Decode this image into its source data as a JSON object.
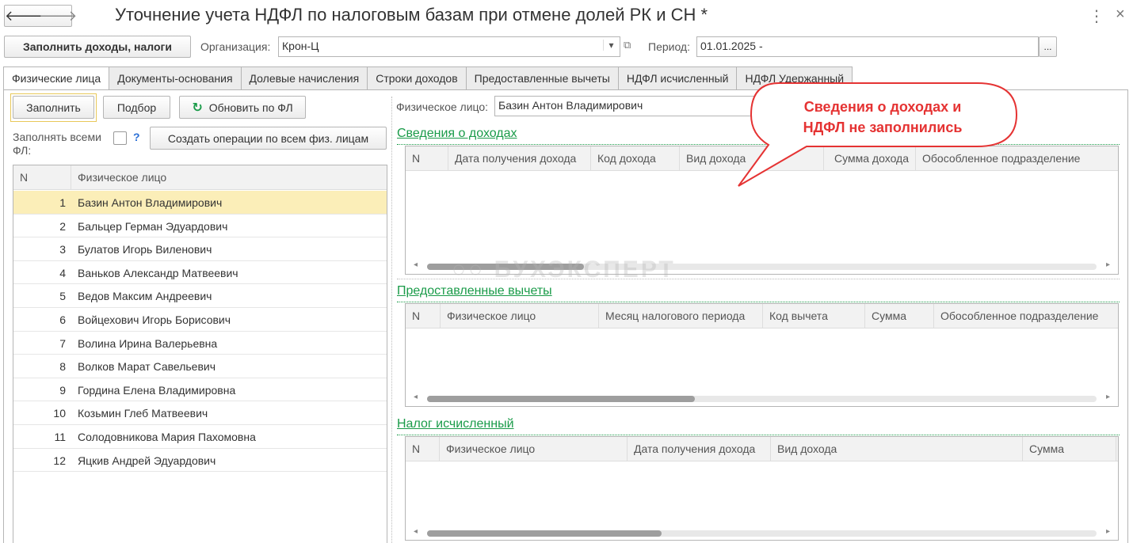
{
  "header": {
    "title": "Уточнение учета НДФЛ по налоговым базам при отмене долей РК и СН *",
    "back_glyph": "🡐",
    "forward_glyph": "🡒",
    "more_glyph": "⋮",
    "close_glyph": "×"
  },
  "toolbar": {
    "fill_button": "Заполнить доходы, налоги",
    "org_label": "Организация:",
    "org_value": "Крон-Ц",
    "period_label": "Период:",
    "period_value": "01.01.2025 -",
    "dropdown_glyph": "▾",
    "open_glyph": "⧉",
    "select_glyph": "..."
  },
  "tabs": [
    "Физические лица",
    "Документы-основания",
    "Долевые начисления",
    "Строки доходов",
    "Предоставленные вычеты",
    "НДФЛ исчисленный",
    "НДФЛ Удержанный"
  ],
  "left": {
    "fill_button": "Заполнить",
    "pick_button": "Подбор",
    "refresh_button": "Обновить по ФЛ",
    "fill_all_label_1": "Заполнять всеми",
    "fill_all_label_2": "ФЛ:",
    "help_glyph": "?",
    "create_ops_button": "Создать операции по всем физ. лицам",
    "table_headers": [
      "N",
      "Физическое лицо"
    ],
    "persons": [
      {
        "n": "1",
        "name": "Базин Антон Владимирович"
      },
      {
        "n": "2",
        "name": "Бальцер Герман Эдуардович"
      },
      {
        "n": "3",
        "name": "Булатов Игорь Виленович"
      },
      {
        "n": "4",
        "name": "Ваньков Александр Матвеевич"
      },
      {
        "n": "5",
        "name": "Ведов Максим Андреевич"
      },
      {
        "n": "6",
        "name": "Войцехович Игорь Борисович"
      },
      {
        "n": "7",
        "name": "Волина Ирина Валерьевна"
      },
      {
        "n": "8",
        "name": "Волков Марат Савельевич"
      },
      {
        "n": "9",
        "name": "Гордина Елена Владимировна"
      },
      {
        "n": "10",
        "name": "Козьмин Глеб Матвеевич"
      },
      {
        "n": "11",
        "name": "Солодовникова Мария Пахомовна"
      },
      {
        "n": "12",
        "name": "Яцкив Андрей Эдуардович"
      }
    ]
  },
  "right": {
    "person_label": "Физическое лицо:",
    "person_value": "Базин Антон Владимирович",
    "income_title": "Сведения о доходах",
    "income_headers": [
      "N",
      "Дата получения дохода",
      "Код дохода",
      "Вид дохода",
      "Сумма дохода",
      "Обособленное подразделение"
    ],
    "deductions_title": "Предоставленные вычеты",
    "deductions_headers": [
      "N",
      "Физическое лицо",
      "Месяц налогового периода",
      "Код вычета",
      "Сумма",
      "Обособленное подразделение"
    ],
    "tax_title": "Налог исчисленный",
    "tax_headers": [
      "N",
      "Физическое лицо",
      "Дата получения дохода",
      "Вид дохода",
      "Сумма"
    ]
  },
  "callout": {
    "line1": "Сведения о доходах и",
    "line2": "НДФЛ не заполнились",
    "color": "#e53333"
  },
  "watermark": "БУХЭКСПЕРТ",
  "colors": {
    "accent_green": "#1a9b49",
    "selected_row": "#fbeeb8",
    "callout_red": "#e53333"
  }
}
